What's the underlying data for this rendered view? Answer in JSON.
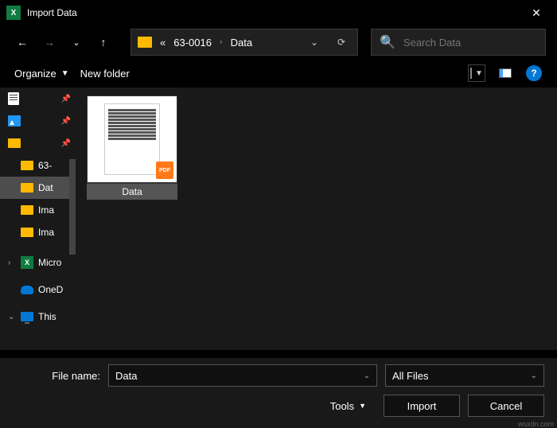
{
  "title": "Import Data",
  "breadcrumb": {
    "prefix": "«",
    "part1": "63-0016",
    "part2": "Data"
  },
  "search": {
    "placeholder": "Search Data"
  },
  "toolbar": {
    "organize": "Organize",
    "newfolder": "New folder"
  },
  "sidebar": {
    "items": [
      {
        "type": "page",
        "label": "",
        "pin": true
      },
      {
        "type": "photo",
        "label": "",
        "pin": true
      },
      {
        "type": "folder",
        "label": "",
        "pin": true
      },
      {
        "type": "folder",
        "label": "63-",
        "child": true
      },
      {
        "type": "folder",
        "label": "Dat",
        "child": true,
        "selected": true
      },
      {
        "type": "folder",
        "label": "Ima",
        "child": true
      },
      {
        "type": "folder",
        "label": "Ima",
        "child": true
      },
      {
        "type": "excel",
        "label": "Micro",
        "chev": ">"
      },
      {
        "type": "onedrive",
        "label": "OneD"
      },
      {
        "type": "monitor",
        "label": "This",
        "chev": "v"
      }
    ]
  },
  "file": {
    "name": "Data",
    "badge": "PDF"
  },
  "footer": {
    "filename_label": "File name:",
    "filename_value": "Data",
    "filter": "All Files",
    "tools": "Tools",
    "import": "Import",
    "cancel": "Cancel"
  },
  "watermark": "wsxdn.com"
}
